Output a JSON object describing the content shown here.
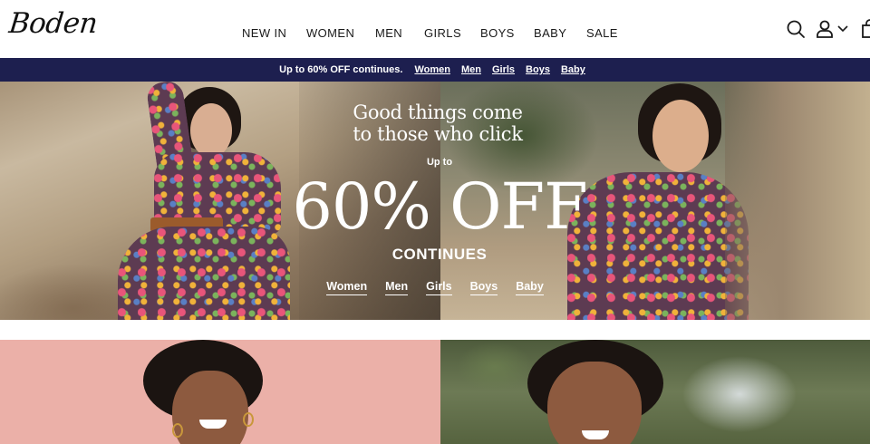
{
  "brand": {
    "logo_text": "Boden"
  },
  "nav": {
    "items": [
      "NEW IN",
      "WOMEN",
      "MEN",
      "GIRLS",
      "BOYS",
      "BABY",
      "SALE"
    ]
  },
  "header_icons": [
    "search-icon",
    "account-icon",
    "chevron-down-icon",
    "bag-icon"
  ],
  "promo": {
    "text": "Up to 60% OFF continues.",
    "links": [
      "Women",
      "Men",
      "Girls",
      "Boys",
      "Baby"
    ]
  },
  "hero": {
    "tagline_line1": "Good things come",
    "tagline_line2": "to those who click",
    "upto": "Up to",
    "offer": "60% OFF",
    "continues": "CONTINUES",
    "links": [
      "Women",
      "Men",
      "Girls",
      "Boys",
      "Baby"
    ]
  },
  "colors": {
    "promo_bg": "#1d1f4f",
    "tile_left_bg": "#ebb0a8",
    "text_dark": "#1c1c1c"
  }
}
